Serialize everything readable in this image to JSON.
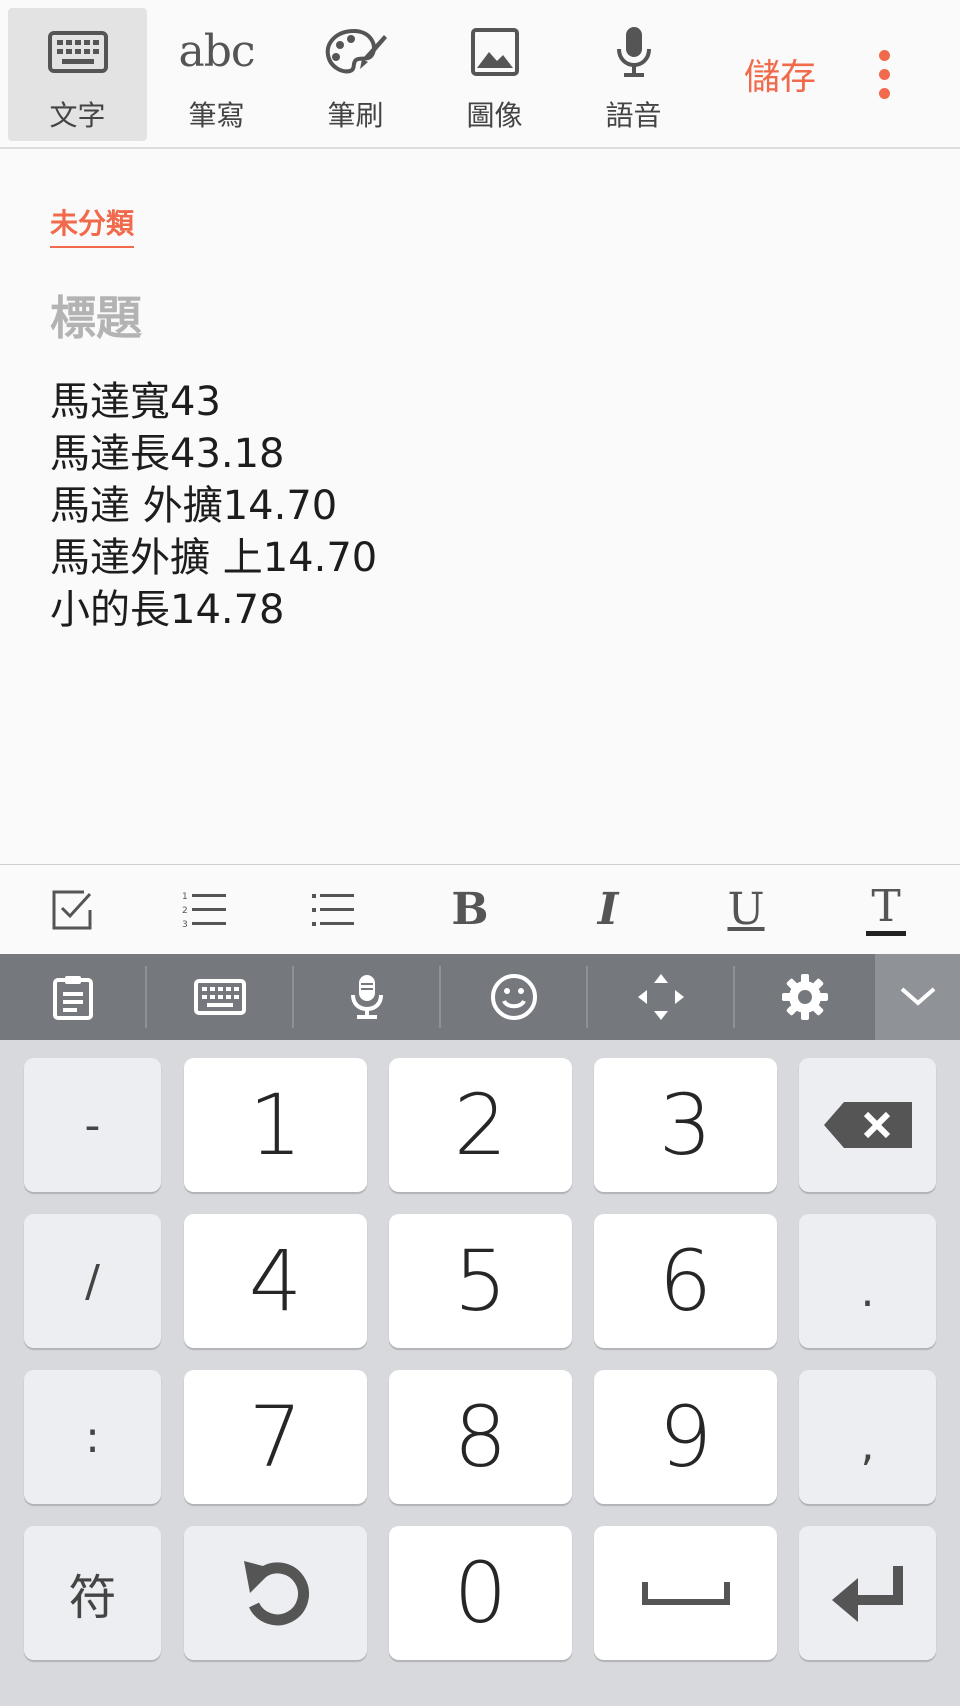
{
  "toolbar": {
    "modes": [
      {
        "label": "文字",
        "icon": "keyboard-icon"
      },
      {
        "label": "筆寫",
        "icon": "handwriting-icon",
        "icon_text": "abc"
      },
      {
        "label": "筆刷",
        "icon": "brush-palette-icon"
      },
      {
        "label": "圖像",
        "icon": "image-icon"
      },
      {
        "label": "語音",
        "icon": "microphone-icon"
      }
    ],
    "active_mode": "文字",
    "save_label": "儲存",
    "accent_color": "#f06a4b"
  },
  "note": {
    "category": "未分類",
    "title_placeholder": "標題",
    "lines": [
      "馬達寬43",
      "馬達長43.18",
      "馬達 外擴14.70",
      "馬達外擴 上14.70",
      "小的長14.78"
    ]
  },
  "format_bar": {
    "items": [
      "checkbox-icon",
      "numbered-list-icon",
      "bullet-list-icon",
      "bold-icon",
      "italic-icon",
      "underline-icon",
      "text-color-icon"
    ],
    "bold_glyph": "B",
    "italic_glyph": "I",
    "underline_glyph": "U",
    "text_color_glyph": "T"
  },
  "keyboard_strip": {
    "items": [
      "clipboard-icon",
      "keyboard-icon",
      "voice-input-icon",
      "emoji-icon",
      "cursor-move-icon",
      "settings-icon",
      "collapse-chevron-icon"
    ]
  },
  "keyboard": {
    "rows": [
      [
        "-",
        "1",
        "2",
        "3",
        "backspace"
      ],
      [
        "/",
        "4",
        "5",
        "6",
        "."
      ],
      [
        ":",
        "7",
        "8",
        "9",
        ","
      ],
      [
        "符",
        "undo",
        "0",
        "space",
        "enter"
      ]
    ]
  }
}
